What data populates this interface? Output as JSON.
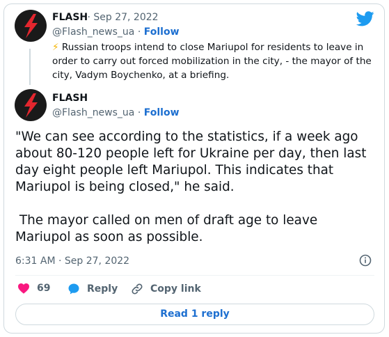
{
  "quoted": {
    "name": "FLASH",
    "date": "Sep 27, 2022",
    "handle": "@Flash_news_ua",
    "follow": "Follow",
    "emoji": "⚡",
    "text": "Russian troops intend to close Mariupol for residents to leave in order to carry out forced mobilization in the city, - the mayor of the city, Vadym Boychenko, at a briefing."
  },
  "tweet": {
    "name": "FLASH",
    "handle": "@Flash_news_ua",
    "follow": "Follow",
    "paragraph1": "\"We can see according to the statistics, if a week ago about 80-120 people left for Ukraine per day, then last day eight people left Mariupol. This indicates that Mariupol is being closed,\" he said.",
    "paragraph2": " The mayor called on men of draft age to leave Mariupol as soon as possible.",
    "timestamp": "6:31 AM · Sep 27, 2022"
  },
  "actions": {
    "likes": "69",
    "reply": "Reply",
    "copy_link": "Copy link"
  },
  "read_reply": "Read 1 reply",
  "colors": {
    "accent": "#1d6fd0",
    "twitter": "#1d9bf0",
    "like": "#f91880",
    "brand_red": "#e3262e",
    "avatar_bg": "#1a1a1a"
  }
}
